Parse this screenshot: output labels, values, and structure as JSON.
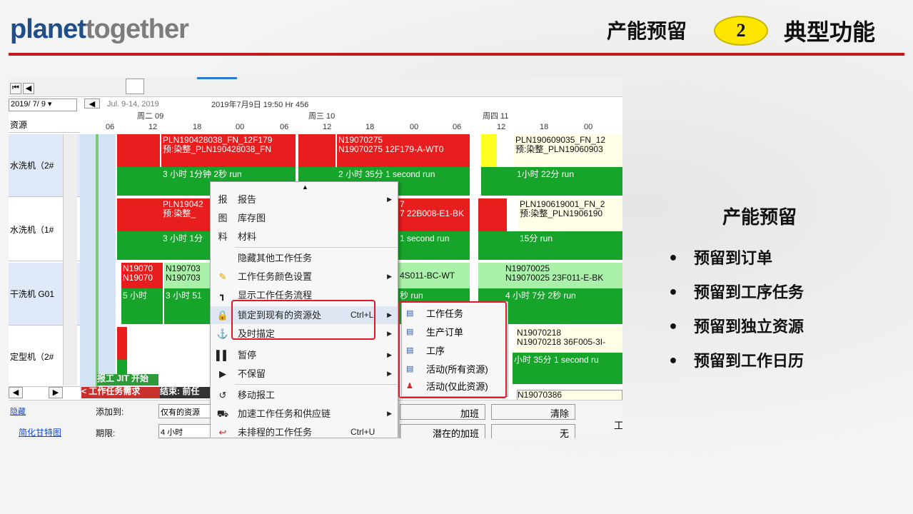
{
  "header": {
    "logo_a": "planet",
    "logo_b": "together",
    "title_left": "产能预留",
    "badge": "2",
    "title_right": "典型功能"
  },
  "side": {
    "title": "产能预留",
    "bullets": [
      "预留到订单",
      "预留到工序任务",
      "预留到独立资源",
      "预留到工作日历"
    ],
    "bullet_char": "•"
  },
  "app": {
    "date_select": "2019/ 7/ 9",
    "range": "Jul. 9-14, 2019",
    "now": "2019年7月9日  19:50   Hr 456",
    "days": [
      "周二 09",
      "周三 10",
      "周四 11"
    ],
    "hours": [
      "06",
      "12",
      "18",
      "00",
      "06",
      "12",
      "18",
      "00",
      "06",
      "12",
      "18",
      "00"
    ],
    "res_header": "资源",
    "resources": [
      "水洗机（2#",
      "水洗机（1#",
      "干洗机 G01",
      "定型机（2#"
    ],
    "blocks": {
      "r1a": "PLN190428038_FN_12F179",
      "r1b": "预:染整_PLN190428038_FN",
      "r1c": "3 小时 1分钟 2秒 run",
      "r1d": "N19070275",
      "r1e": "N19070275 12F179-A-WT0",
      "r1f": "2 小时 35分 1 second run",
      "r1g": "PLN190609035_FN_12",
      "r1h": "预:染整_PLN19060903",
      "r1i": "1小时 22分 run",
      "r2a": "PLN19042",
      "r2b": "预:染整_",
      "r2c": "3 小时 1分",
      "r2d": "7",
      "r2e": "7 22B008-E1-BK",
      "r2f": "1 second run",
      "r2g": "PLN190619001_FN_2",
      "r2h": "预:染整_PLN1906190",
      "r2i": "15分 run",
      "r3a": "N19070",
      "r3b": "N19070",
      "r3c": "5 小时",
      "r3d": "N190703",
      "r3e": "N190703",
      "r3f": "3 小时 51",
      "r3g": "4S011-BC-WT",
      "r3h": "秒 run",
      "r3i": "N19070025",
      "r3j": "N19070025 23F011-E-BK",
      "r3k": "4 小时 7分 2秒 run",
      "r4a": "N19070218",
      "r4b": "N19070218 36F005-3I-",
      "r4c": "小时 35分 1 second ru",
      "r5": "N19070386",
      "tag1": "报工 JIT 开始",
      "tag2": "< 工作任务需求",
      "tag3": "结束: 前任"
    },
    "menu": [
      {
        "icon": "报",
        "label": "报告",
        "sc": "",
        "arrow": "▶"
      },
      {
        "icon": "图",
        "label": "库存图",
        "sc": "",
        "arrow": ""
      },
      {
        "icon": "料",
        "label": "材料",
        "sc": "",
        "arrow": ""
      },
      {
        "icon": "",
        "label": "隐藏其他工作任务",
        "sc": "",
        "arrow": ""
      },
      {
        "icon": "✎",
        "label": "工作任务颜色设置",
        "sc": "",
        "arrow": "▶"
      },
      {
        "icon": "┓",
        "label": "显示工作任务流程",
        "sc": "",
        "arrow": ""
      },
      {
        "icon": "🔒",
        "label": "锁定到现有的资源处",
        "sc": "Ctrl+L",
        "arrow": "▶"
      },
      {
        "icon": "⚓",
        "label": "及时描定",
        "sc": "",
        "arrow": "▶"
      },
      {
        "icon": "▌▌",
        "label": "暂停",
        "sc": "",
        "arrow": "▶"
      },
      {
        "icon": "▶",
        "label": "不保留",
        "sc": "",
        "arrow": "▶"
      },
      {
        "icon": "↺",
        "label": "移动报工",
        "sc": "",
        "arrow": ""
      },
      {
        "icon": "⛟",
        "label": "加速工作任务和供应链",
        "sc": "",
        "arrow": "▶"
      },
      {
        "icon": "↩",
        "label": "未排程的工作任务",
        "sc": "Ctrl+U",
        "arrow": ""
      }
    ],
    "submenu": [
      "工作任务",
      "生产订单",
      "工序",
      "活动(所有资源)",
      "活动(仅此资源)"
    ],
    "bottom": {
      "hide": "隐藏",
      "gantt": "简化甘特图",
      "add_to": "添加到:",
      "add_val": "仅有的资源",
      "period": "期限:",
      "period_val": "4 小时",
      "overtime": "加班",
      "potential": "潜在的加班",
      "clear": "清除",
      "none": "无",
      "t": "工"
    }
  }
}
